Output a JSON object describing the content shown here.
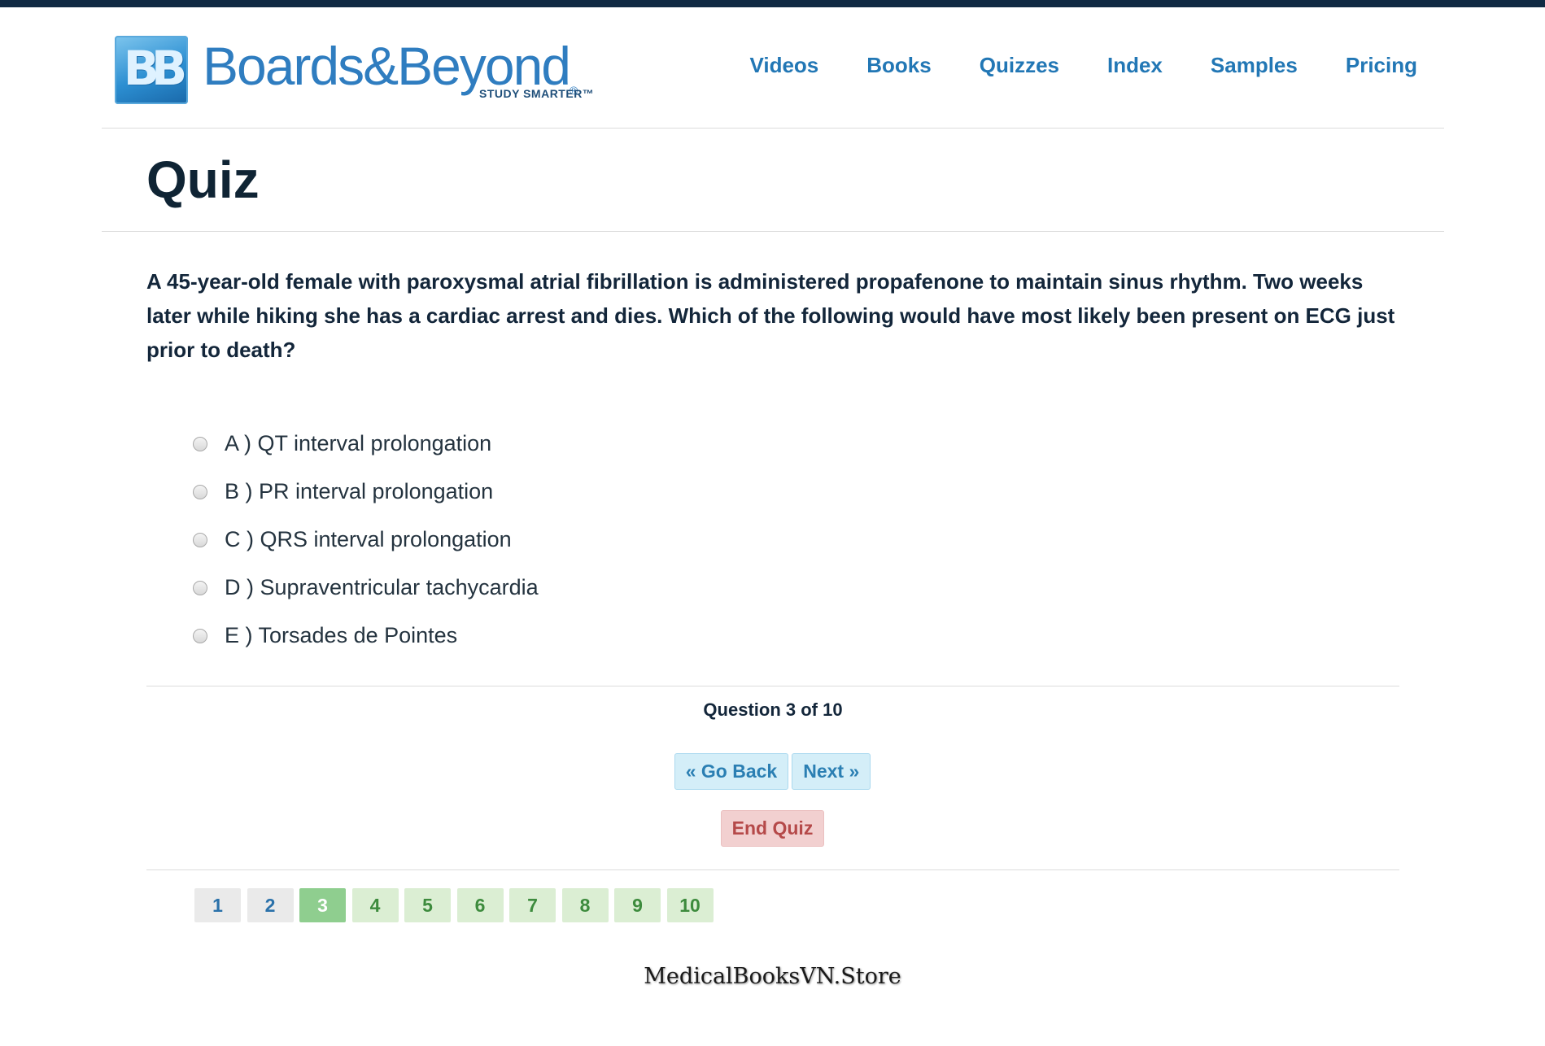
{
  "brand": {
    "badge": "BB",
    "name": "Boards&Beyond",
    "registered": "®",
    "tagline": "STUDY SMARTER™"
  },
  "nav": {
    "items": [
      "Videos",
      "Books",
      "Quizzes",
      "Index",
      "Samples",
      "Pricing"
    ]
  },
  "page": {
    "title": "Quiz"
  },
  "question": {
    "text": "A 45-year-old female with paroxysmal atrial fibrillation is administered propafenone to maintain sinus rhythm.  Two weeks later while hiking she has a cardiac arrest and dies. Which of the following would have most likely been present on ECG just prior to death?",
    "options": [
      "A ) QT interval prolongation",
      "B ) PR interval prolongation",
      "C ) QRS interval prolongation",
      "D ) Supraventricular tachycardia",
      "E ) Torsades de Pointes"
    ]
  },
  "progress": {
    "text": "Question 3 of 10"
  },
  "buttons": {
    "go_back": "« Go Back",
    "next": "Next »",
    "end_quiz": "End Quiz"
  },
  "pager": {
    "pages": [
      "1",
      "2",
      "3",
      "4",
      "5",
      "6",
      "7",
      "8",
      "9",
      "10"
    ],
    "current": 3
  },
  "watermark": "MedicalBooksVN.Store",
  "colors": {
    "topbar": "#102a43",
    "nav_link": "#2277b5",
    "current_page": "#8fce8f",
    "pending_page": "#dbeed3",
    "end_quiz_bg": "#f2d0d0"
  }
}
